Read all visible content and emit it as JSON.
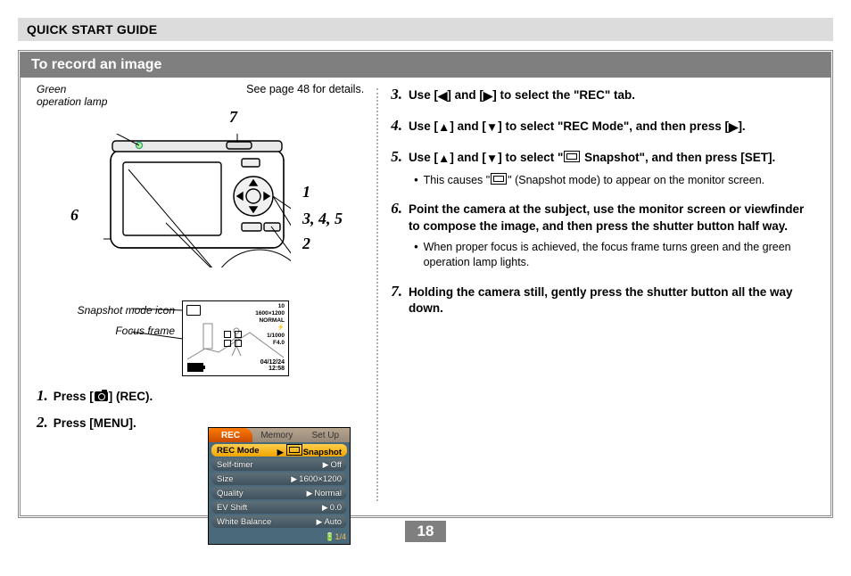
{
  "header": "QUICK START GUIDE",
  "section_title": "To record an image",
  "see_page": "See page 48 for details.",
  "left_labels": {
    "lamp_label_line1": "Green",
    "lamp_label_line2": "operation lamp",
    "snapshot_icon_label": "Snapshot mode icon",
    "focus_frame_label": "Focus frame"
  },
  "diagram_numbers": {
    "n7": "7",
    "n1": "1",
    "n345": "3, 4, 5",
    "n2": "2",
    "n6": "6"
  },
  "lcd_overlay": {
    "shots_remaining": "10",
    "resolution": "1600×1200",
    "quality": "NORMAL",
    "flash_icon": "⚡",
    "shutter": "1/1000",
    "aperture": "F4.0",
    "date": "04/12/24",
    "time": "12:58"
  },
  "steps_left": [
    {
      "idx": "1.",
      "pre": "Press [",
      "icon": "camera",
      "post": "] (REC)."
    },
    {
      "idx": "2.",
      "pre": "Press [MENU].",
      "icon": "",
      "post": ""
    }
  ],
  "menu": {
    "tabs": [
      "REC",
      "Memory",
      "Set Up"
    ],
    "rows": [
      {
        "label": "REC Mode",
        "value": "Snapshot",
        "selected": true,
        "icon": true
      },
      {
        "label": "Self-timer",
        "value": "Off",
        "selected": false,
        "icon": false
      },
      {
        "label": "Size",
        "value": "1600×1200",
        "selected": false,
        "icon": false
      },
      {
        "label": "Quality",
        "value": "Normal",
        "selected": false,
        "icon": false
      },
      {
        "label": "EV Shift",
        "value": "0.0",
        "selected": false,
        "icon": false
      },
      {
        "label": "White Balance",
        "value": "Auto",
        "selected": false,
        "icon": false
      }
    ],
    "footer": "1/4"
  },
  "steps_right": [
    {
      "idx": "3.",
      "text_parts": [
        "Use [",
        "◀",
        "] and [",
        "▶",
        "] to select the \"REC\" tab."
      ],
      "note": ""
    },
    {
      "idx": "4.",
      "text_parts": [
        "Use [",
        "▲",
        "] and [",
        "▼",
        "] to select \"REC Mode\", and then press [",
        "▶",
        "]."
      ],
      "note": ""
    },
    {
      "idx": "5.",
      "text_parts": [
        "Use [",
        "▲",
        "] and [",
        "▼",
        "] to select \"",
        "SNAP_ICON",
        " Snapshot\", and then press [SET]."
      ],
      "note_parts": [
        "This causes \"",
        "SNAP_ICON",
        "\" (Snapshot mode) to appear on the monitor screen."
      ]
    },
    {
      "idx": "6.",
      "text_parts": [
        "Point the camera at the subject, use the monitor screen or viewfinder to compose the image, and then press the shutter button half way."
      ],
      "note_parts": [
        "When proper focus is achieved, the focus frame turns green and the green operation lamp lights."
      ]
    },
    {
      "idx": "7.",
      "text_parts": [
        "Holding the camera still, gently press the shutter button all the way down."
      ],
      "note": ""
    }
  ],
  "page_number": "18"
}
